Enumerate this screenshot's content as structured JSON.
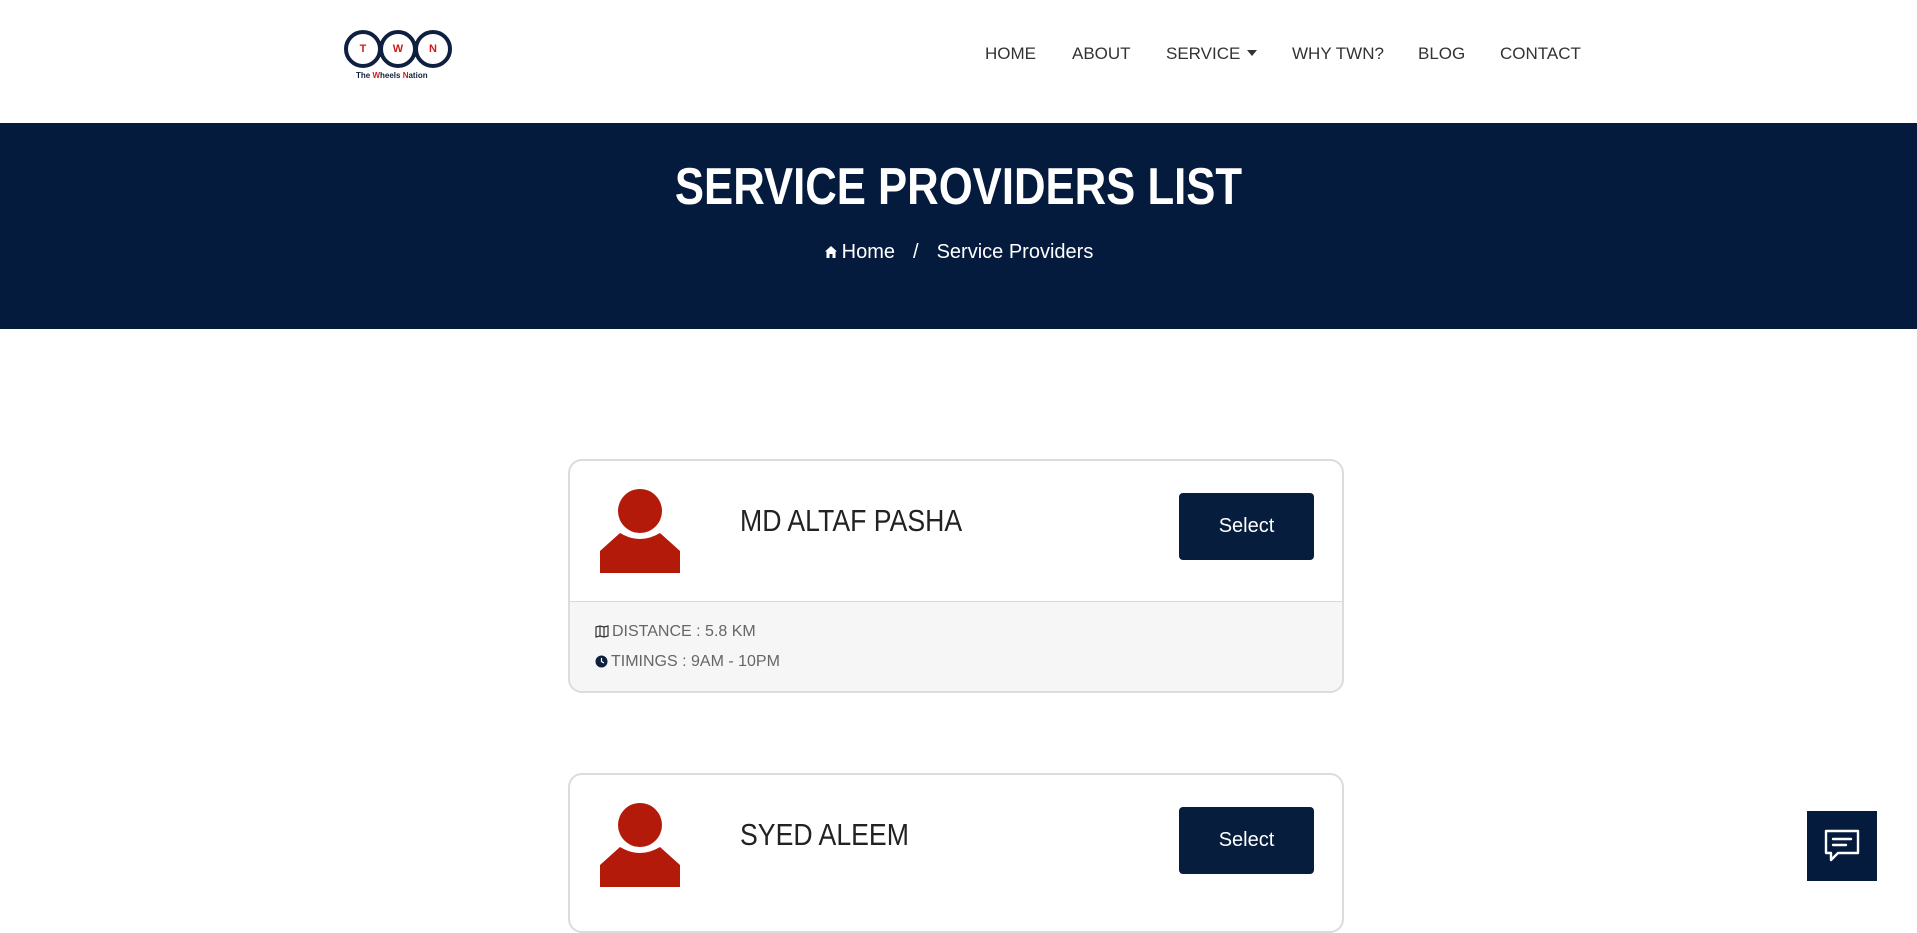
{
  "logo": {
    "letters": [
      "T",
      "W",
      "N"
    ],
    "tagline_parts": [
      "The ",
      "W",
      "heels ",
      "N",
      "ation"
    ]
  },
  "nav": {
    "home": "HOME",
    "about": "ABOUT",
    "service": "SERVICE",
    "why": "WHY TWN?",
    "blog": "BLOG",
    "contact": "CONTACT"
  },
  "banner": {
    "title": "SERVICE PROVIDERS LIST",
    "breadcrumb": {
      "home": "Home",
      "separator": "/",
      "current": "Service Providers"
    }
  },
  "providers": [
    {
      "name": "MD ALTAF PASHA",
      "button": "Select",
      "distance": "DISTANCE : 5.8 KM",
      "timings": "TIMINGS : 9AM - 10PM"
    },
    {
      "name": "SYED ALEEM",
      "button": "Select"
    }
  ],
  "colors": {
    "navy": "#041b3d",
    "button": "#071d3e",
    "avatar_red": "#b41a0a"
  },
  "icons": {
    "home": "home-icon",
    "distance": "map-icon",
    "timings": "clock-icon",
    "chat": "chat-icon",
    "avatar": "person-icon"
  }
}
